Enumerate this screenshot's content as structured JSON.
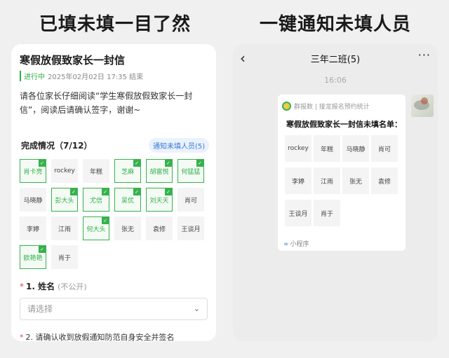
{
  "headlines": {
    "left": "已填未填一目了然",
    "right": "一键通知未填人员"
  },
  "notice": {
    "title": "寒假放假致家长一封信",
    "status": "进行中",
    "deadline": "2025年02月02日 17:35 结束",
    "body": "请各位家长仔细阅读“学生寒假放假致家长一封信”，阅读后请确认签字，谢谢~",
    "progress_label": "完成情况（7/12）",
    "notify_button": "通知未填人员(5)"
  },
  "roster": [
    {
      "name": "肖卡亮",
      "done": true
    },
    {
      "name": "rockey",
      "done": false
    },
    {
      "name": "年糕",
      "done": false
    },
    {
      "name": "芝麻",
      "done": true
    },
    {
      "name": "胡富悦",
      "done": true
    },
    {
      "name": "何猛猛",
      "done": true
    },
    {
      "name": "马晓静",
      "done": false
    },
    {
      "name": "彭大头",
      "done": true
    },
    {
      "name": "尤信",
      "done": true
    },
    {
      "name": "吴优",
      "done": true
    },
    {
      "name": "刘天天",
      "done": true
    },
    {
      "name": "肖可",
      "done": false
    },
    {
      "name": "李婷",
      "done": false
    },
    {
      "name": "江雨",
      "done": false
    },
    {
      "name": "何大头",
      "done": true
    },
    {
      "name": "张无",
      "done": false
    },
    {
      "name": "袁修",
      "done": false
    },
    {
      "name": "王谈月",
      "done": false
    },
    {
      "name": "欧艳艳",
      "done": true
    },
    {
      "name": "肖于",
      "done": false
    }
  ],
  "form": {
    "q1_number": "1. 姓名",
    "q1_hint": "(不公开)",
    "q1_placeholder": "请选择",
    "q2": "2. 请确认收到放假通知防范自身安全并签名"
  },
  "chat": {
    "title": "三年二班(5)",
    "time": "16:06",
    "card_source": "群报数 | 接龙报名预约统计",
    "card_title": "寒假放假致家长一封信未填名单：",
    "pending": [
      "rockey",
      "年糕",
      "马晓静",
      "肖可",
      "李婷",
      "江雨",
      "张无",
      "袁修",
      "王谈月",
      "肖于"
    ],
    "footer": "小程序"
  },
  "colors": {
    "accent_green": "#37b24d",
    "accent_blue": "#3a78d6"
  },
  "icons": {
    "back": "chevron-left-icon",
    "more": "more-dots-icon",
    "chevron": "chevron-down-icon",
    "check": "check-icon",
    "link": "mini-program-icon"
  }
}
